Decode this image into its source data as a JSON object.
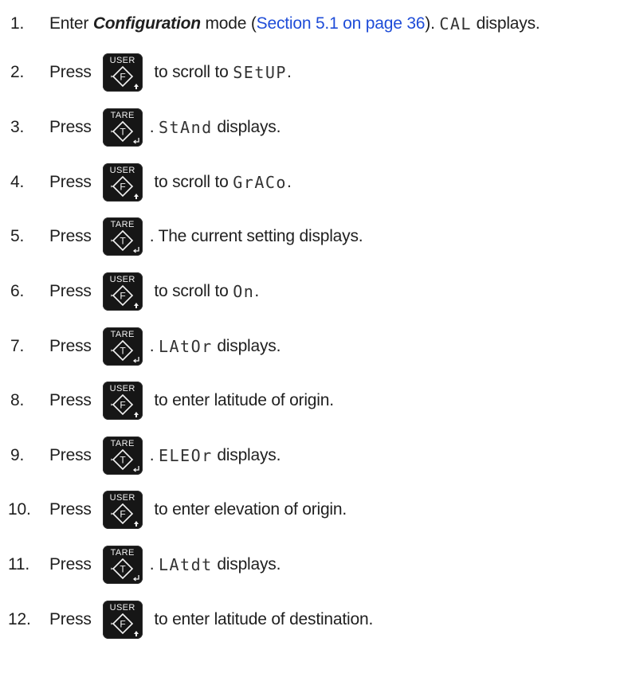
{
  "steps": [
    {
      "number": "1.",
      "prefix": "Enter ",
      "emphasis": "Configuration",
      "middle": " mode (",
      "link": "Section 5.1 on page 36",
      "after_link": "). ",
      "display": "CAL",
      "suffix": " displays."
    },
    {
      "number": "2.",
      "press": "Press",
      "key": "USER",
      "before": " to scroll to ",
      "display": "SEtUP",
      "suffix": "."
    },
    {
      "number": "3.",
      "press": "Press",
      "key": "TARE",
      "before": ". ",
      "display": "StAnd",
      "suffix": " displays."
    },
    {
      "number": "4.",
      "press": "Press",
      "key": "USER",
      "before": " to scroll to ",
      "display": "GrACo",
      "suffix": "."
    },
    {
      "number": "5.",
      "press": "Press",
      "key": "TARE",
      "before": ". The current setting displays.",
      "display": "",
      "suffix": ""
    },
    {
      "number": "6.",
      "press": "Press",
      "key": "USER",
      "before": " to scroll to ",
      "display": "On",
      "suffix": "."
    },
    {
      "number": "7.",
      "press": "Press",
      "key": "TARE",
      "before": ". ",
      "display": "LAtOr",
      "suffix": " displays."
    },
    {
      "number": "8.",
      "press": "Press",
      "key": "USER",
      "before": " to enter latitude of origin.",
      "display": "",
      "suffix": ""
    },
    {
      "number": "9.",
      "press": "Press",
      "key": "TARE",
      "before": ". ",
      "display": "ELEOr",
      "suffix": " displays."
    },
    {
      "number": "10.",
      "press": "Press",
      "key": "USER",
      "before": " to enter elevation of origin.",
      "display": "",
      "suffix": ""
    },
    {
      "number": "11.",
      "press": "Press",
      "key": "TARE",
      "before": ". ",
      "display": "LAtdt",
      "suffix": " displays."
    },
    {
      "number": "12.",
      "press": "Press",
      "key": "USER",
      "before": " to enter latitude of destination.",
      "display": "",
      "suffix": ""
    }
  ],
  "keys": {
    "USER": {
      "label": "USER",
      "glyph": "F"
    },
    "TARE": {
      "label": "TARE",
      "glyph": "T"
    }
  },
  "colors": {
    "link": "#1f4dd8",
    "key_background": "#161616",
    "text": "#1f1f1f"
  }
}
